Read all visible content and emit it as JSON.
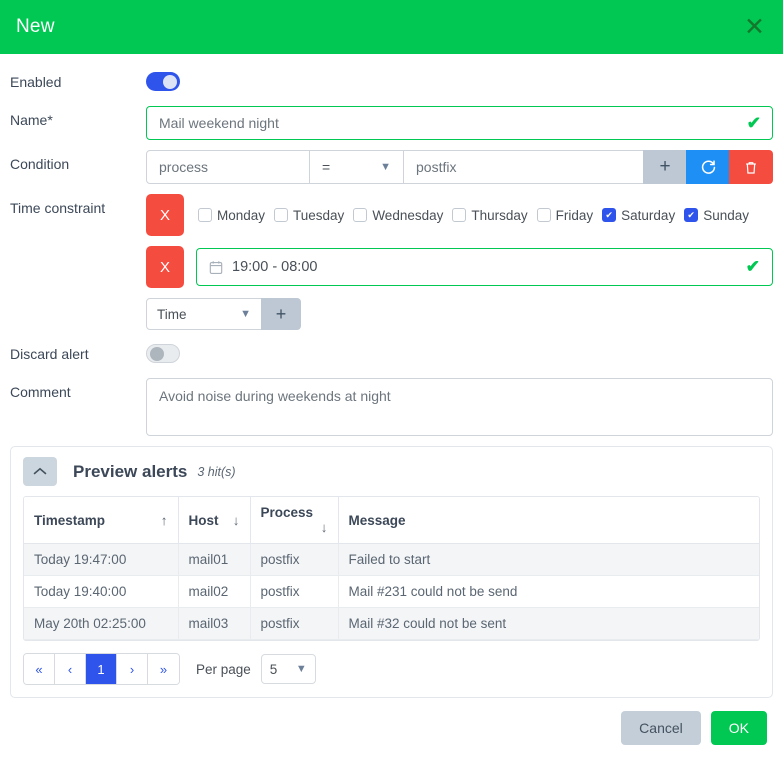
{
  "header": {
    "title": "New",
    "close_icon": "close-icon"
  },
  "fields": {
    "enabled_label": "Enabled",
    "enabled_value": "on",
    "name_label": "Name*",
    "name_value": "Mail weekend night",
    "condition_label": "Condition",
    "condition_key": "process",
    "condition_operator": "=",
    "condition_value": "postfix",
    "condition_add_icon": "plus-icon",
    "condition_refresh_icon": "refresh-icon",
    "condition_delete_icon": "trash-icon",
    "time_constraint_label": "Time constraint",
    "remove_label": "X",
    "days": [
      {
        "label": "Monday",
        "checked": false
      },
      {
        "label": "Tuesday",
        "checked": false
      },
      {
        "label": "Wednesday",
        "checked": false
      },
      {
        "label": "Thursday",
        "checked": false
      },
      {
        "label": "Friday",
        "checked": false
      },
      {
        "label": "Saturday",
        "checked": true
      },
      {
        "label": "Sunday",
        "checked": true
      }
    ],
    "time_range": "19:00 - 08:00",
    "time_type_option": "Time",
    "time_add_icon": "plus-icon",
    "discard_label": "Discard alert",
    "discard_value": "off",
    "comment_label": "Comment",
    "comment_value": "Avoid noise during weekends at night"
  },
  "preview": {
    "collapse_icon": "chevron-up-icon",
    "title": "Preview alerts",
    "hits": "3 hit(s)",
    "columns": [
      {
        "label": "Timestamp",
        "sort": "↑"
      },
      {
        "label": "Host",
        "sort": "↓"
      },
      {
        "label": "Process",
        "sort": "↓"
      },
      {
        "label": "Message",
        "sort": ""
      }
    ],
    "rows": [
      {
        "timestamp": "Today 19:47:00",
        "host": "mail01",
        "process": "postfix",
        "message": "Failed to start"
      },
      {
        "timestamp": "Today 19:40:00",
        "host": "mail02",
        "process": "postfix",
        "message": "Mail #231 could not be send"
      },
      {
        "timestamp": "May 20th 02:25:00",
        "host": "mail03",
        "process": "postfix",
        "message": "Mail #32 could not be sent"
      }
    ],
    "pagination": {
      "first": "«",
      "prev": "‹",
      "current": "1",
      "next": "›",
      "last": "»",
      "per_page_label": "Per page",
      "per_page_value": "5"
    }
  },
  "footer": {
    "cancel_label": "Cancel",
    "ok_label": "OK"
  },
  "colors": {
    "brand_green": "#00c853",
    "accent_blue": "#2f54eb",
    "danger_red": "#f54c40",
    "info_blue": "#1e90f5",
    "muted_gray": "#bdc8d4"
  }
}
